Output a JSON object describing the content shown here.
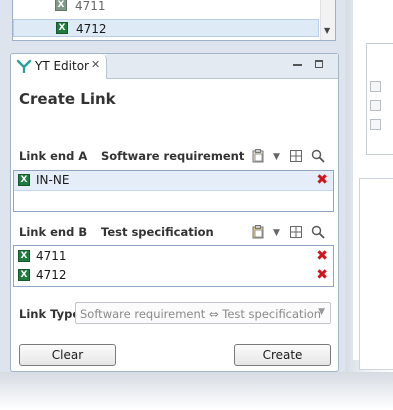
{
  "top_list": {
    "items": [
      {
        "label": "4711"
      },
      {
        "label": "4712"
      }
    ]
  },
  "editor": {
    "tab_title": "YT Editor",
    "heading": "Create Link",
    "link_end_a": {
      "label": "Link end A",
      "type": "Software requirement",
      "items": [
        {
          "label": "IN-NE"
        }
      ]
    },
    "link_end_b": {
      "label": "Link end B",
      "type": "Test specification",
      "items": [
        {
          "label": "4711"
        },
        {
          "label": "4712"
        }
      ]
    },
    "link_type": {
      "label": "Link Type",
      "value": "Software requirement ⇔ Test specification"
    },
    "clear_label": "Clear",
    "create_label": "Create"
  },
  "icons": [
    "excel-file-icon",
    "yt-editor-icon",
    "close-icon",
    "minimize-icon",
    "maximize-icon",
    "paste-icon",
    "dropdown-arrow-icon",
    "table-icon",
    "search-icon",
    "delete-icon"
  ],
  "colors": {
    "delete": "#d0141b",
    "excel": "#1f7a3d",
    "selection": "#e4edf8"
  }
}
